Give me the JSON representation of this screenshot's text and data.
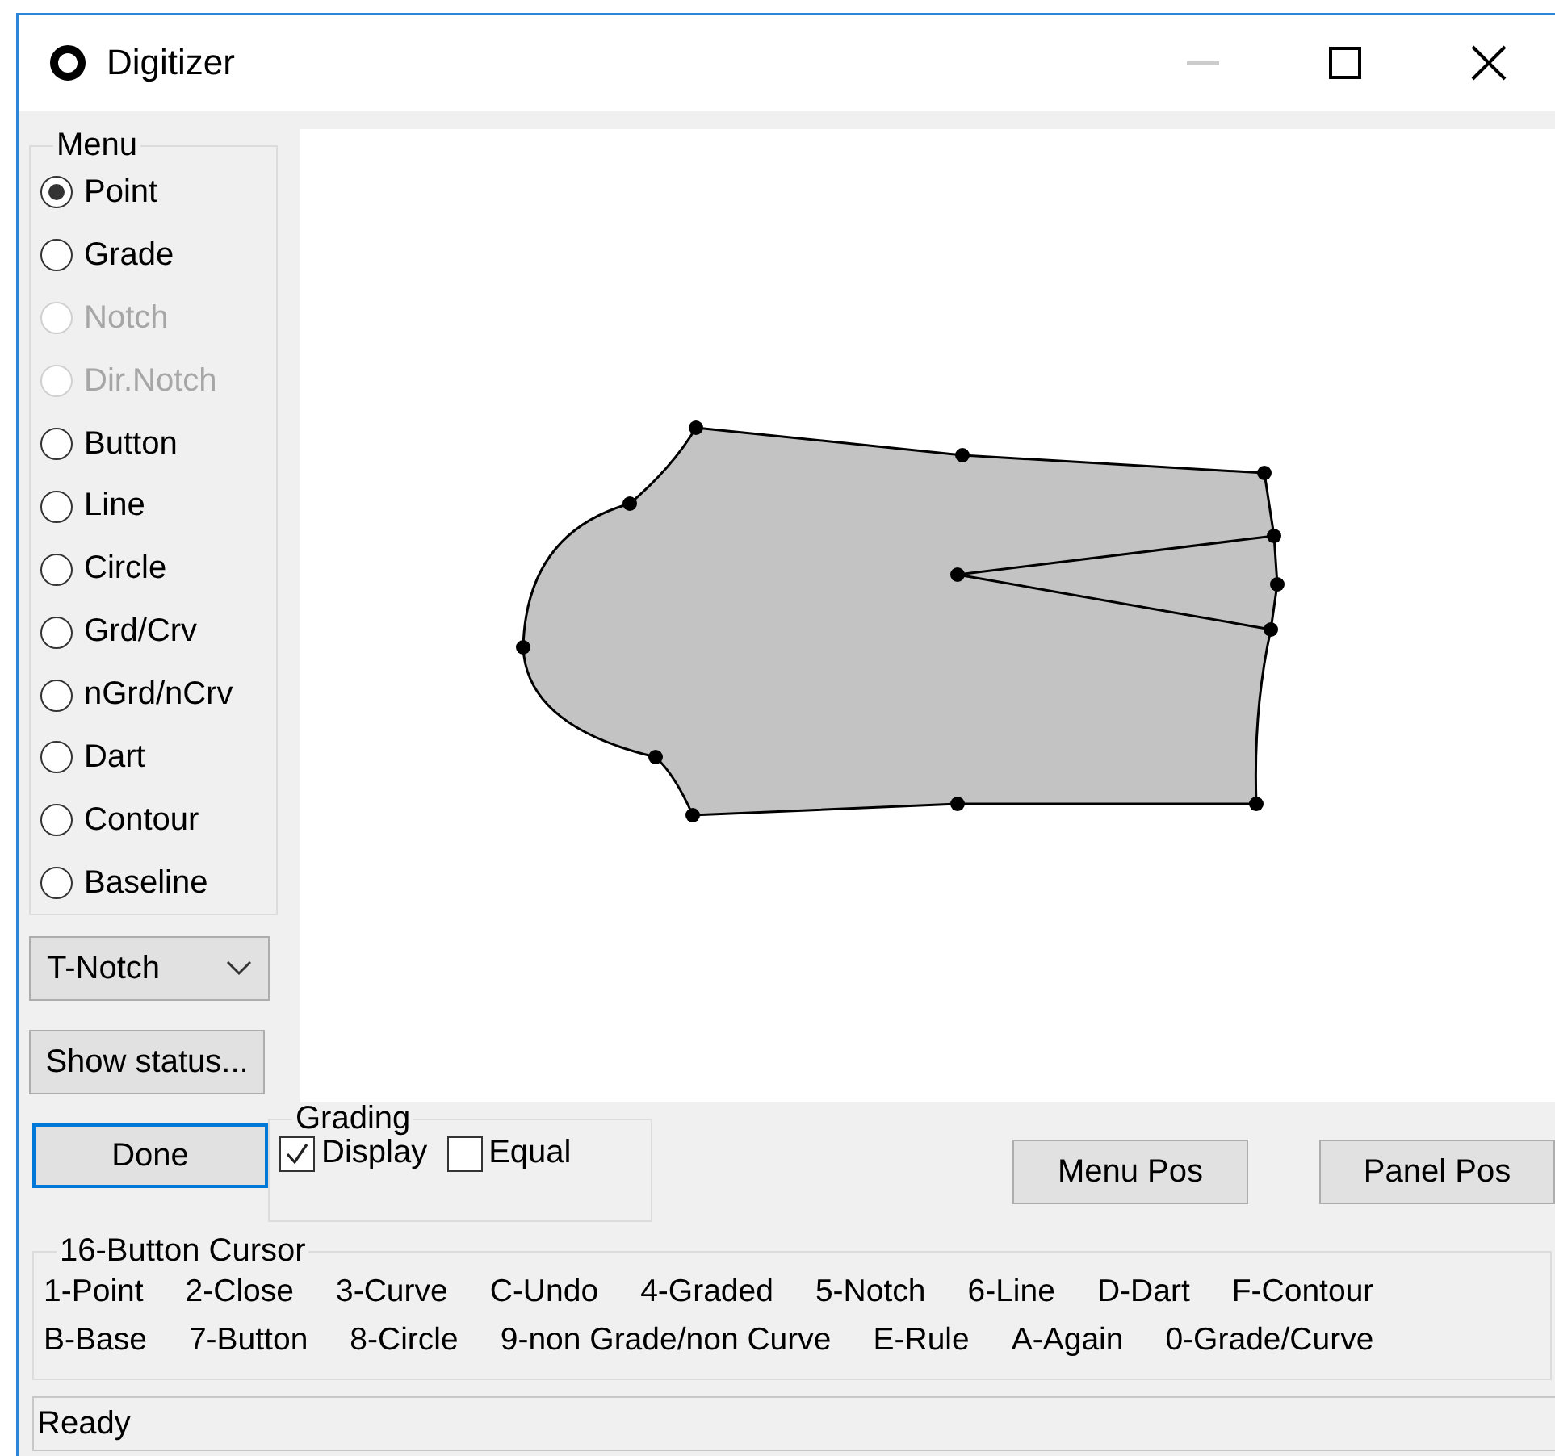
{
  "window": {
    "title": "Digitizer"
  },
  "menu": {
    "label": "Menu",
    "items": [
      {
        "label": "Point",
        "selected": true,
        "disabled": false
      },
      {
        "label": "Grade",
        "selected": false,
        "disabled": false
      },
      {
        "label": "Notch",
        "selected": false,
        "disabled": true
      },
      {
        "label": "Dir.Notch",
        "selected": false,
        "disabled": true
      },
      {
        "label": "Button",
        "selected": false,
        "disabled": false
      },
      {
        "label": "Line",
        "selected": false,
        "disabled": false
      },
      {
        "label": "Circle",
        "selected": false,
        "disabled": false
      },
      {
        "label": "Grd/Crv",
        "selected": false,
        "disabled": false
      },
      {
        "label": "nGrd/nCrv",
        "selected": false,
        "disabled": false
      },
      {
        "label": "Dart",
        "selected": false,
        "disabled": false
      },
      {
        "label": "Contour",
        "selected": false,
        "disabled": false
      },
      {
        "label": "Baseline",
        "selected": false,
        "disabled": false
      }
    ]
  },
  "notch_type": {
    "value": "T-Notch"
  },
  "show_status_button": {
    "label": "Show status..."
  },
  "done_button": {
    "label": "Done",
    "focused": true
  },
  "grading": {
    "label": "Grading",
    "options": [
      {
        "label": "Display",
        "checked": true
      },
      {
        "label": "Equal",
        "checked": false
      }
    ]
  },
  "position_buttons": [
    "Menu Pos",
    "Panel Pos"
  ],
  "cursor_legend": {
    "label": "16-Button Cursor",
    "keys": [
      "1-Point",
      "2-Close",
      "3-Curve",
      "C-Undo",
      "4-Graded",
      "5-Notch",
      "6-Line",
      "D-Dart",
      "F-Contour",
      "B-Base",
      "7-Button",
      "8-Circle",
      "9-non Grade/non Curve",
      "E-Rule",
      "A-Again",
      "0-Grade/Curve"
    ]
  },
  "status_bar": {
    "text": "Ready"
  }
}
